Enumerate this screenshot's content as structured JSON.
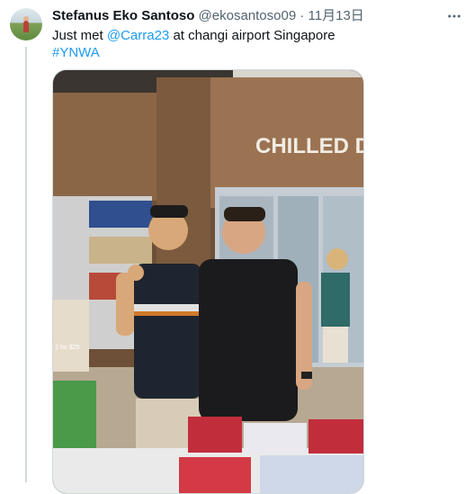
{
  "tweet": {
    "author_name": "Stefanus Eko Santoso",
    "author_handle": "@ekosantoso09",
    "separator": "·",
    "date": "11月13日",
    "text_parts": {
      "prefix": "Just met ",
      "mention": "@Carra23",
      "suffix": " at changi airport Singapore"
    },
    "hashtag": "#YNWA",
    "more_icon": "more-horizontal-icon"
  },
  "photo": {
    "store_sign": "CHILLED D",
    "price_tag": "3 for $25"
  },
  "colors": {
    "link": "#1d9bf0",
    "secondary_text": "#536471",
    "thread_line": "#cfd9de"
  }
}
